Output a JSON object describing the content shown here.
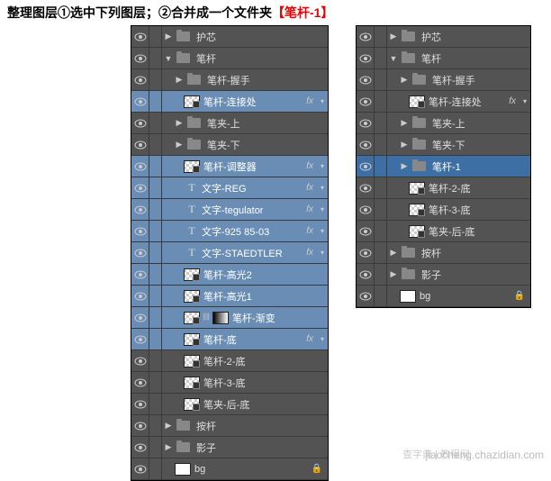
{
  "instruction": {
    "part1": "整理图层①选中下列图层；②合并成一个文件夹",
    "part2": "【笔杆-1】"
  },
  "left_panel": {
    "rows": [
      {
        "type": "folder",
        "name": "护芯",
        "indent": 0,
        "collapsed": true,
        "selected": false
      },
      {
        "type": "folder",
        "name": "笔杆",
        "indent": 0,
        "collapsed": false,
        "selected": false
      },
      {
        "type": "folder",
        "name": "笔杆-握手",
        "indent": 1,
        "collapsed": true,
        "selected": false
      },
      {
        "type": "smart",
        "name": "笔杆-连接处",
        "indent": 1,
        "selected": true,
        "fx": true
      },
      {
        "type": "folder",
        "name": "笔夹-上",
        "indent": 1,
        "collapsed": true,
        "selected": false
      },
      {
        "type": "folder",
        "name": "笔夹-下",
        "indent": 1,
        "collapsed": true,
        "selected": false
      },
      {
        "type": "smart",
        "name": "笔杆-调整器",
        "indent": 1,
        "selected": true,
        "fx": true
      },
      {
        "type": "text",
        "name": "文字-REG",
        "indent": 1,
        "selected": true,
        "fx": true
      },
      {
        "type": "text",
        "name": "文字-tegulator",
        "indent": 1,
        "selected": true,
        "fx": true
      },
      {
        "type": "text",
        "name": "文字-925 85-03",
        "indent": 1,
        "selected": true,
        "fx": true
      },
      {
        "type": "text",
        "name": "文字-STAEDTLER",
        "indent": 1,
        "selected": true,
        "fx": true
      },
      {
        "type": "layer",
        "name": "笔杆-高光2",
        "indent": 1,
        "selected": true,
        "smart": true
      },
      {
        "type": "layer",
        "name": "笔杆-高光1",
        "indent": 1,
        "selected": true,
        "smart": true
      },
      {
        "type": "smartmask",
        "name": "笔杆-渐变",
        "indent": 1,
        "selected": true
      },
      {
        "type": "smart",
        "name": "笔杆-底",
        "indent": 1,
        "selected": true,
        "fx": true
      },
      {
        "type": "smart",
        "name": "笔杆-2-底",
        "indent": 1,
        "selected": false
      },
      {
        "type": "smart",
        "name": "笔杆-3-底",
        "indent": 1,
        "selected": false
      },
      {
        "type": "smart",
        "name": "笔夹-后-底",
        "indent": 1,
        "selected": false
      },
      {
        "type": "folder",
        "name": "按杆",
        "indent": 0,
        "collapsed": true,
        "selected": false
      },
      {
        "type": "folder",
        "name": "影子",
        "indent": 0,
        "collapsed": true,
        "selected": false
      },
      {
        "type": "bg",
        "name": "bg",
        "indent": 0,
        "selected": false,
        "locked": true
      }
    ]
  },
  "right_panel": {
    "rows": [
      {
        "type": "folder",
        "name": "护芯",
        "indent": 0,
        "collapsed": true
      },
      {
        "type": "folder",
        "name": "笔杆",
        "indent": 0,
        "collapsed": false
      },
      {
        "type": "folder",
        "name": "笔杆-握手",
        "indent": 1,
        "collapsed": true
      },
      {
        "type": "smart",
        "name": "笔杆-连接处",
        "indent": 1,
        "fx": true
      },
      {
        "type": "folder",
        "name": "笔夹-上",
        "indent": 1,
        "collapsed": true
      },
      {
        "type": "folder",
        "name": "笔夹-下",
        "indent": 1,
        "collapsed": true
      },
      {
        "type": "folder",
        "name": "笔杆-1",
        "indent": 1,
        "collapsed": true,
        "highlight": true
      },
      {
        "type": "smart",
        "name": "笔杆-2-底",
        "indent": 1
      },
      {
        "type": "smart",
        "name": "笔杆-3-底",
        "indent": 1
      },
      {
        "type": "smart",
        "name": "笔夹-后-底",
        "indent": 1
      },
      {
        "type": "folder",
        "name": "按杆",
        "indent": 0,
        "collapsed": true
      },
      {
        "type": "folder",
        "name": "影子",
        "indent": 0,
        "collapsed": true
      },
      {
        "type": "bg",
        "name": "bg",
        "indent": 0,
        "locked": true
      }
    ]
  },
  "fx_label": "fx",
  "watermark": "查字典 | 教程网",
  "watermark_url": "jiaocheng.chazidian.com"
}
